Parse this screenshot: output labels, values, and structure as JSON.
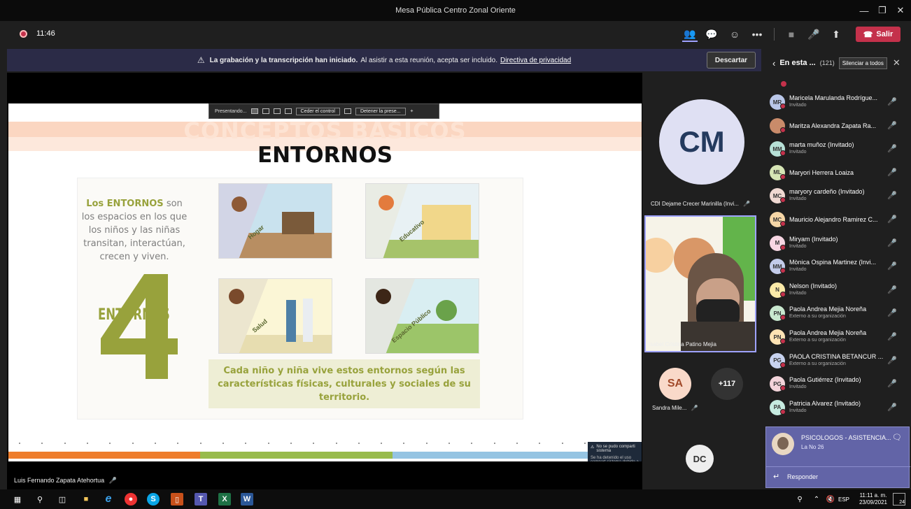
{
  "window": {
    "title": "Mesa Pública Centro Zonal Oriente"
  },
  "toolbar": {
    "timer": "11:46",
    "leave_label": "Salir"
  },
  "banner": {
    "bold": "La grabación y la transcripción han iniciado.",
    "text": "Al asistir a esta reunión, acepta ser incluido.",
    "link": "Directiva de privacidad",
    "dismiss": "Descartar"
  },
  "share_bar": {
    "presenting": "Presentando...",
    "give_control": "Ceder el control",
    "stop": "Detener la prese..."
  },
  "slide": {
    "watermark": "CONCEPTOS BASICOS",
    "title": "ENTORNOS",
    "intro_hl": "Los ENTORNOS",
    "intro_rest": "son los espacios en los que los niños y las niñas transitan, interactúan, crecen y viven.",
    "big_number": "4",
    "big_label": "ENTORNOS",
    "environments": [
      "Hogar",
      "Educativo",
      "Salud",
      "Espacio Público"
    ],
    "caption": "Cada niño y niña vive estos entornos según las características físicas, culturales y sociales de su territorio.",
    "error_title": "No se pudo comparti sistema",
    "error_body": "Se ha detenido el uso compart sistema debido a un error"
  },
  "presenter": {
    "name": "Luis Fernando Zapata Atehortua"
  },
  "tiles": {
    "cm": {
      "initials": "CM",
      "name": "CDI Dejame Crecer Marinilla (Invi..."
    },
    "video": {
      "name": "Isabel Cristina Patino Mejia"
    },
    "sa": {
      "initials": "SA",
      "name": "Sandra Mile..."
    },
    "more": "+117",
    "dc": {
      "initials": "DC"
    }
  },
  "panel": {
    "title": "En esta ...",
    "count": "(121)",
    "mute_all": "Silenciar a todos",
    "participants": [
      {
        "initials": "MR",
        "name": "Maricela Marulanda Rodrígue...",
        "sub": "Invitado",
        "color": "#b9c6e8"
      },
      {
        "initials": "",
        "name": "Maritza Alexandra Zapata Ra...",
        "sub": "",
        "color": "#c98b6a"
      },
      {
        "initials": "MM",
        "name": "marta muñoz (Invitado)",
        "sub": "Invitado",
        "color": "#b6e0d6"
      },
      {
        "initials": "ML",
        "name": "Maryori Herrera Loaiza",
        "sub": "",
        "color": "#d6e5b5"
      },
      {
        "initials": "MC",
        "name": "maryory cardeño (Invitado)",
        "sub": "Invitado",
        "color": "#f0d9d2"
      },
      {
        "initials": "MC",
        "name": "Mauricio Alejandro Ramirez C...",
        "sub": "",
        "color": "#f6d6a6"
      },
      {
        "initials": "M",
        "name": "Miryam (Invitado)",
        "sub": "Invitado",
        "color": "#f7d6e3"
      },
      {
        "initials": "MM",
        "name": "Mònica Ospina Martinez (Invi...",
        "sub": "Invitado",
        "color": "#c3cbe9"
      },
      {
        "initials": "N",
        "name": "Nelson (Invitado)",
        "sub": "Invitado",
        "color": "#fbeaa8"
      },
      {
        "initials": "PN",
        "name": "Paola Andrea Mejia Noreña",
        "sub": "Externo a su organización",
        "color": "#c9e8cf"
      },
      {
        "initials": "PN",
        "name": "Paola Andrea Mejia Noreña",
        "sub": "Externo a su organización",
        "color": "#fde3b4"
      },
      {
        "initials": "PG",
        "name": "PAOLA CRISTINA BETANCUR ...",
        "sub": "Externo a su organización",
        "color": "#c7d2ef"
      },
      {
        "initials": "PG",
        "name": "Paola Gutiérrez (Invitado)",
        "sub": "Invitado",
        "color": "#f3d4da"
      },
      {
        "initials": "PA",
        "name": "Patricia Alvarez (Invitado)",
        "sub": "Invitado",
        "color": "#c6ebe0"
      }
    ],
    "chat_title": "PSICOLOGOS - ASISTENCIA...",
    "chat_text": "La No 26",
    "reply": "Responder"
  },
  "taskbar": {
    "time": "11:11 a. m.",
    "date": "23/09/2021",
    "lang": "ESP",
    "notif": "24"
  },
  "colors": {
    "accent": "#6264a7",
    "leave": "#c4314b",
    "olive": "#98a23c"
  }
}
